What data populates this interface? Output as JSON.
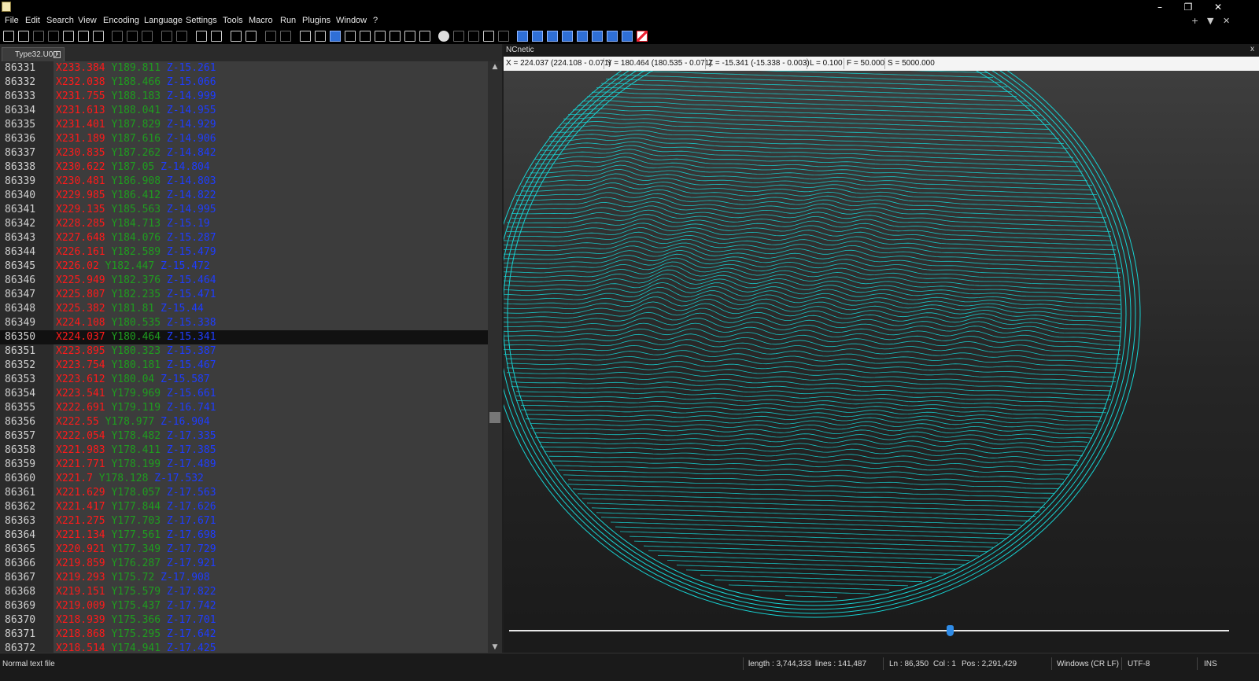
{
  "titlebar": {
    "app_icon": "notepad-icon",
    "minimize": "–",
    "restore": "❐",
    "close": "✕"
  },
  "menu": {
    "items": [
      "File",
      "Edit",
      "Search",
      "View",
      "Encoding",
      "Language",
      "Settings",
      "Tools",
      "Macro",
      "Run",
      "Plugins",
      "Window",
      "?"
    ],
    "right": [
      "+",
      "▼",
      "✕"
    ]
  },
  "tab": {
    "label": "Type32.U00"
  },
  "editor": {
    "lines": [
      {
        "n": "86331",
        "x": "X233.384",
        "y": "Y189.811",
        "z": "Z-15.261"
      },
      {
        "n": "86332",
        "x": "X232.038",
        "y": "Y188.466",
        "z": "Z-15.066"
      },
      {
        "n": "86333",
        "x": "X231.755",
        "y": "Y188.183",
        "z": "Z-14.999"
      },
      {
        "n": "86334",
        "x": "X231.613",
        "y": "Y188.041",
        "z": "Z-14.955"
      },
      {
        "n": "86335",
        "x": "X231.401",
        "y": "Y187.829",
        "z": "Z-14.929"
      },
      {
        "n": "86336",
        "x": "X231.189",
        "y": "Y187.616",
        "z": "Z-14.906"
      },
      {
        "n": "86337",
        "x": "X230.835",
        "y": "Y187.262",
        "z": "Z-14.842"
      },
      {
        "n": "86338",
        "x": "X230.622",
        "y": "Y187.05",
        "z": "Z-14.804"
      },
      {
        "n": "86339",
        "x": "X230.481",
        "y": "Y186.908",
        "z": "Z-14.803"
      },
      {
        "n": "86340",
        "x": "X229.985",
        "y": "Y186.412",
        "z": "Z-14.822"
      },
      {
        "n": "86341",
        "x": "X229.135",
        "y": "Y185.563",
        "z": "Z-14.995"
      },
      {
        "n": "86342",
        "x": "X228.285",
        "y": "Y184.713",
        "z": "Z-15.19"
      },
      {
        "n": "86343",
        "x": "X227.648",
        "y": "Y184.076",
        "z": "Z-15.287"
      },
      {
        "n": "86344",
        "x": "X226.161",
        "y": "Y182.589",
        "z": "Z-15.479"
      },
      {
        "n": "86345",
        "x": "X226.02",
        "y": "Y182.447",
        "z": "Z-15.472"
      },
      {
        "n": "86346",
        "x": "X225.949",
        "y": "Y182.376",
        "z": "Z-15.464"
      },
      {
        "n": "86347",
        "x": "X225.807",
        "y": "Y182.235",
        "z": "Z-15.471"
      },
      {
        "n": "86348",
        "x": "X225.382",
        "y": "Y181.81",
        "z": "Z-15.44"
      },
      {
        "n": "86349",
        "x": "X224.108",
        "y": "Y180.535",
        "z": "Z-15.338"
      },
      {
        "n": "86350",
        "x": "X224.037",
        "y": "Y180.464",
        "z": "Z-15.341",
        "current": true
      },
      {
        "n": "86351",
        "x": "X223.895",
        "y": "Y180.323",
        "z": "Z-15.387"
      },
      {
        "n": "86352",
        "x": "X223.754",
        "y": "Y180.181",
        "z": "Z-15.467"
      },
      {
        "n": "86353",
        "x": "X223.612",
        "y": "Y180.04",
        "z": "Z-15.587"
      },
      {
        "n": "86354",
        "x": "X223.541",
        "y": "Y179.969",
        "z": "Z-15.661"
      },
      {
        "n": "86355",
        "x": "X222.691",
        "y": "Y179.119",
        "z": "Z-16.741"
      },
      {
        "n": "86356",
        "x": "X222.55",
        "y": "Y178.977",
        "z": "Z-16.904"
      },
      {
        "n": "86357",
        "x": "X222.054",
        "y": "Y178.482",
        "z": "Z-17.335"
      },
      {
        "n": "86358",
        "x": "X221.983",
        "y": "Y178.411",
        "z": "Z-17.385"
      },
      {
        "n": "86359",
        "x": "X221.771",
        "y": "Y178.199",
        "z": "Z-17.489"
      },
      {
        "n": "86360",
        "x": "X221.7",
        "y": "Y178.128",
        "z": "Z-17.532"
      },
      {
        "n": "86361",
        "x": "X221.629",
        "y": "Y178.057",
        "z": "Z-17.563"
      },
      {
        "n": "86362",
        "x": "X221.417",
        "y": "Y177.844",
        "z": "Z-17.626"
      },
      {
        "n": "86363",
        "x": "X221.275",
        "y": "Y177.703",
        "z": "Z-17.671"
      },
      {
        "n": "86364",
        "x": "X221.134",
        "y": "Y177.561",
        "z": "Z-17.698"
      },
      {
        "n": "86365",
        "x": "X220.921",
        "y": "Y177.349",
        "z": "Z-17.729"
      },
      {
        "n": "86366",
        "x": "X219.859",
        "y": "Y176.287",
        "z": "Z-17.921"
      },
      {
        "n": "86367",
        "x": "X219.293",
        "y": "Y175.72",
        "z": "Z-17.908"
      },
      {
        "n": "86368",
        "x": "X219.151",
        "y": "Y175.579",
        "z": "Z-17.822"
      },
      {
        "n": "86369",
        "x": "X219.009",
        "y": "Y175.437",
        "z": "Z-17.742"
      },
      {
        "n": "86370",
        "x": "X218.939",
        "y": "Y175.366",
        "z": "Z-17.701"
      },
      {
        "n": "86371",
        "x": "X218.868",
        "y": "Y175.295",
        "z": "Z-17.642"
      },
      {
        "n": "86372",
        "x": "X218.514",
        "y": "Y174.941",
        "z": "Z-17.425"
      }
    ]
  },
  "ncnetic": {
    "title": "NCnetic",
    "close": "x",
    "coords": {
      "x": "X = 224.037 (224.108 - 0.071)",
      "y": "Y = 180.464 (180.535 - 0.071)",
      "z": "Z = -15.341 (-15.338 - 0.003)",
      "l": "L = 0.100",
      "f": "F = 50.000",
      "s": "S = 5000.000"
    },
    "slider_position": 0.612,
    "toolpath_color": "#17d4d4"
  },
  "status": {
    "file_type": "Normal text file",
    "length": "length : 3,744,333",
    "lines": "lines : 141,487",
    "ln": "Ln : 86,350",
    "col": "Col : 1",
    "pos": "Pos : 2,291,429",
    "eol": "Windows (CR LF)",
    "encoding": "UTF-8",
    "mode": "INS"
  }
}
